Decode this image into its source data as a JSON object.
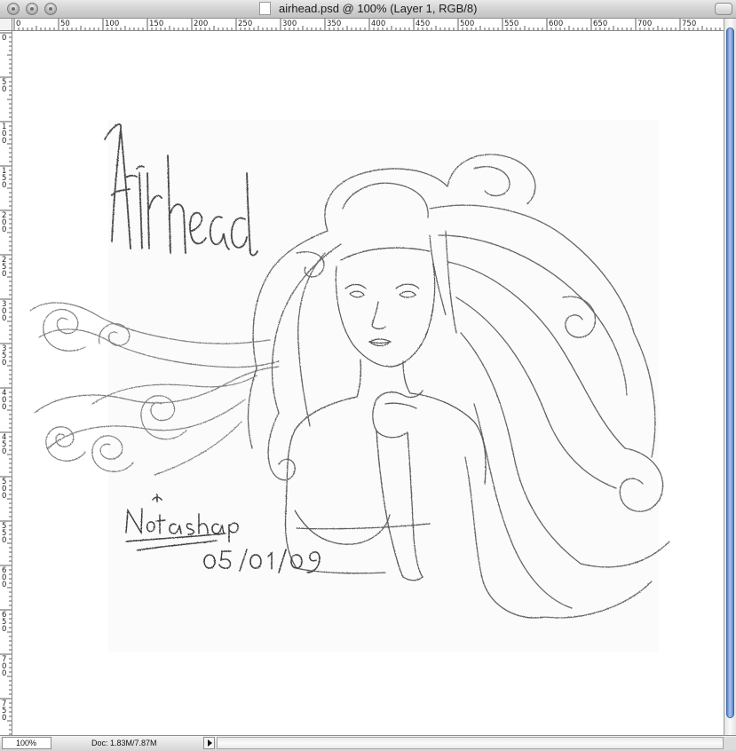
{
  "window": {
    "title": "airhead.psd @ 100% (Layer 1, RGB/8)"
  },
  "rulers": {
    "top_labels": [
      "0",
      "50",
      "100",
      "150",
      "200",
      "250",
      "300",
      "350",
      "400",
      "450",
      "500",
      "550",
      "600",
      "650",
      "700",
      "750"
    ],
    "left_labels": [
      "0",
      "50",
      "100",
      "150",
      "200",
      "250",
      "300",
      "350",
      "400",
      "450",
      "500",
      "550",
      "600",
      "650",
      "700",
      "750"
    ]
  },
  "artwork": {
    "title_lettering": "Airhead",
    "signature": "Natashape",
    "date": "05/01/09"
  },
  "status": {
    "zoom": "100%",
    "doc_info": "Doc: 1.83M/7.87M"
  },
  "icons": {
    "close": "close-icon",
    "minimize": "minimize-icon",
    "zoom": "zoom-icon",
    "document": "document-icon",
    "menu_arrow": "triangle-right-icon"
  }
}
